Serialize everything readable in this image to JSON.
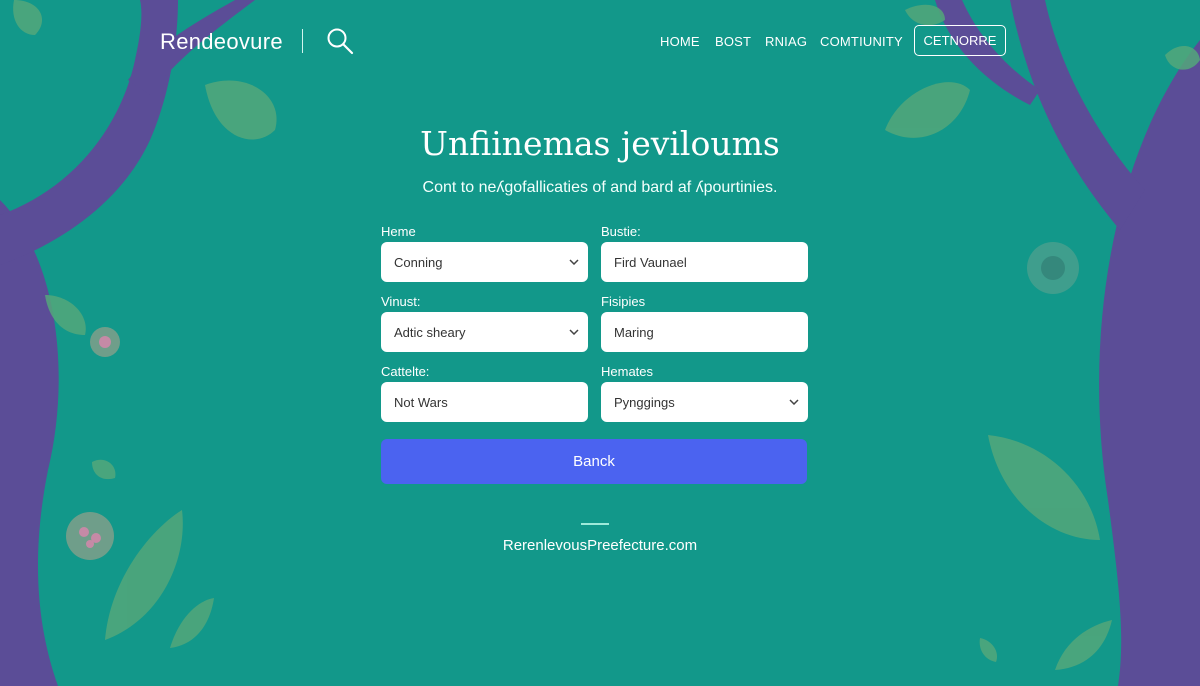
{
  "header": {
    "logo": "Rendeovure",
    "nav": [
      "HOME",
      "BOST",
      "RNIAG",
      "COMTIUNITY"
    ],
    "cta": "CETNORRE"
  },
  "hero": {
    "title": "Unfiinemas jeviloums",
    "subtitle": "Cont to neʎgofallicaties of and bard af ʎpourtinies."
  },
  "form": {
    "fields": [
      {
        "label": "Heme",
        "value": "Conning",
        "type": "select"
      },
      {
        "label": "Bustie:",
        "value": "Fird Vaunael",
        "type": "text"
      },
      {
        "label": "Vinust:",
        "value": "Adtic sheary",
        "type": "select"
      },
      {
        "label": "Fisipies",
        "value": "Maring",
        "type": "text"
      },
      {
        "label": "Cattelte:",
        "value": "Not Wars",
        "type": "text"
      },
      {
        "label": "Hemates",
        "value": "Pynggings",
        "type": "select"
      }
    ],
    "submit_label": "Banck"
  },
  "footer": {
    "text": "RerenlevousPreefecture.com"
  },
  "colors": {
    "background": "#12988a",
    "tree": "#5b4d97",
    "leaf": "#53a77a",
    "button": "#4b63f0"
  },
  "icons": [
    "search-icon",
    "chevron-down-icon"
  ]
}
